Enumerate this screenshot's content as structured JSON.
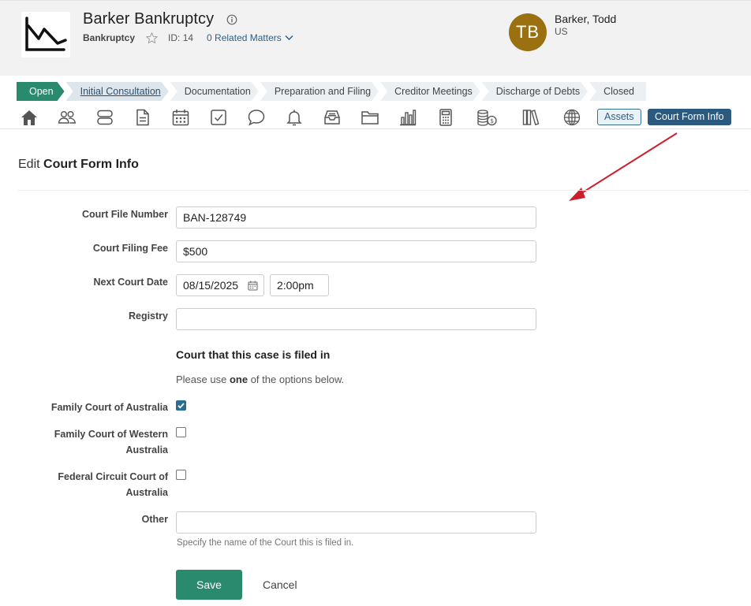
{
  "header": {
    "matter_title": "Barker Bankruptcy",
    "matter_type": "Bankruptcy",
    "matter_id": "ID: 14",
    "related_matters": "0 Related Matters",
    "client": {
      "initials": "TB",
      "name": "Barker, Todd",
      "country": "US",
      "avatar_color": "#9a7010"
    }
  },
  "stages": [
    {
      "label": "Open"
    },
    {
      "label": "Initial Consultation"
    },
    {
      "label": "Documentation"
    },
    {
      "label": "Preparation and Filing"
    },
    {
      "label": "Creditor Meetings"
    },
    {
      "label": "Discharge of Debts"
    },
    {
      "label": "Closed"
    }
  ],
  "toolbar": {
    "icons": [
      "home-icon",
      "contacts-icon",
      "database-icon",
      "document-icon",
      "calendar-icon",
      "task-icon",
      "chat-icon",
      "bell-icon",
      "inbox-icon",
      "folder-icon",
      "bar-chart-icon",
      "calculator-icon",
      "coins-icon",
      "library-icon",
      "globe-icon"
    ],
    "tabs": {
      "assets": "Assets",
      "court_form_info": "Court Form Info"
    }
  },
  "page": {
    "heading_prefix": "Edit",
    "heading_main": "Court Form Info"
  },
  "form": {
    "court_file_number": {
      "label": "Court File Number",
      "value": "BAN-128749"
    },
    "court_filing_fee": {
      "label": "Court Filing Fee",
      "value": "$500"
    },
    "next_court_date": {
      "label": "Next Court Date",
      "date": "08/15/2025",
      "time": "2:00pm"
    },
    "registry": {
      "label": "Registry",
      "value": ""
    },
    "section_title": "Court that this case is filed in",
    "help_prefix": "Please use",
    "help_bold": "one",
    "help_suffix": "of the options below.",
    "family_court": {
      "label": "Family Court of Australia",
      "checked": true
    },
    "wa_court_line1": "Family Court of Western",
    "wa_court_line2": "Australia",
    "fed_court_line1": "Federal Circuit Court of",
    "fed_court_line2": "Australia",
    "other": {
      "label": "Other",
      "value": "",
      "hint": "Specify the name of the Court this is filed in."
    }
  },
  "actions": {
    "save": "Save",
    "cancel": "Cancel"
  },
  "colors": {
    "primary_green": "#2a8a6e",
    "primary_blue": "#2b5a7e",
    "annotation_arrow": "#cc1f2d"
  }
}
